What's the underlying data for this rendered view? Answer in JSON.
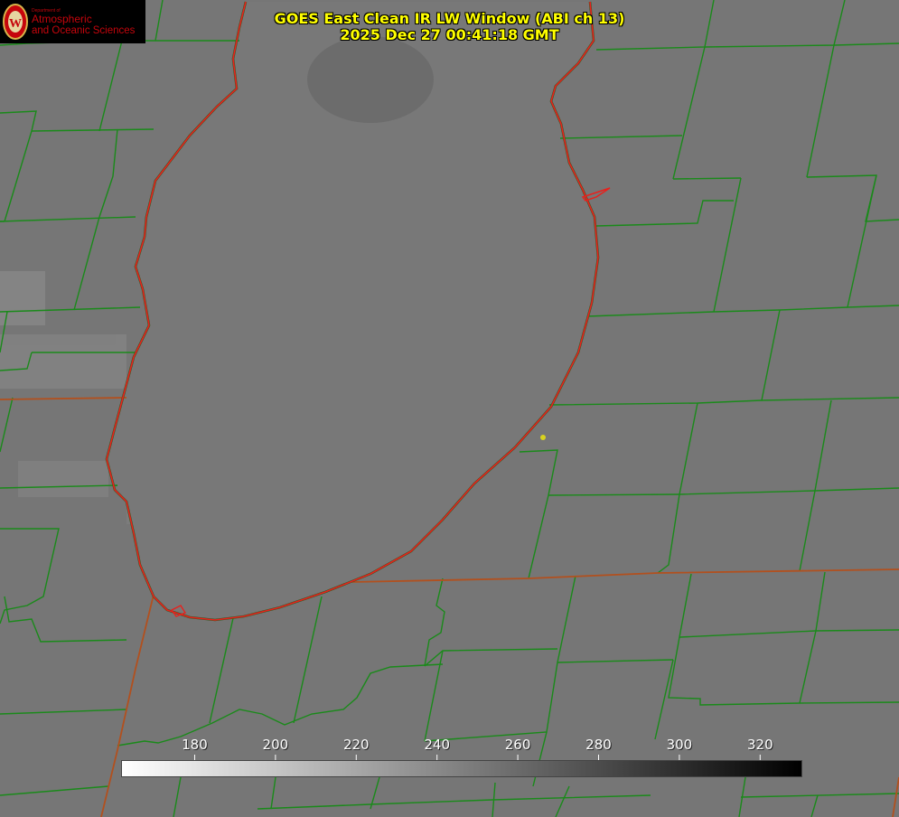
{
  "title": {
    "line1": "GOES East Clean IR LW Window (ABI ch 13)",
    "line2": "2025 Dec 27 00:41:18 GMT"
  },
  "logo": {
    "dept": "Department of",
    "line1": "Atmospheric",
    "line2": "and Oceanic Sciences",
    "seal_letter": "W"
  },
  "colorbar": {
    "ticks": [
      "180",
      "200",
      "220",
      "240",
      "260",
      "280",
      "300",
      "320"
    ],
    "range": [
      162,
      330
    ],
    "gradient": "white-to-black"
  },
  "colors": {
    "background": "#767676",
    "lake_outline": "#e8211d",
    "county_borders": "#1a8a1a",
    "state_border": "#b2501e",
    "title_text": "#ffff00",
    "marker": "#d8d21e"
  }
}
